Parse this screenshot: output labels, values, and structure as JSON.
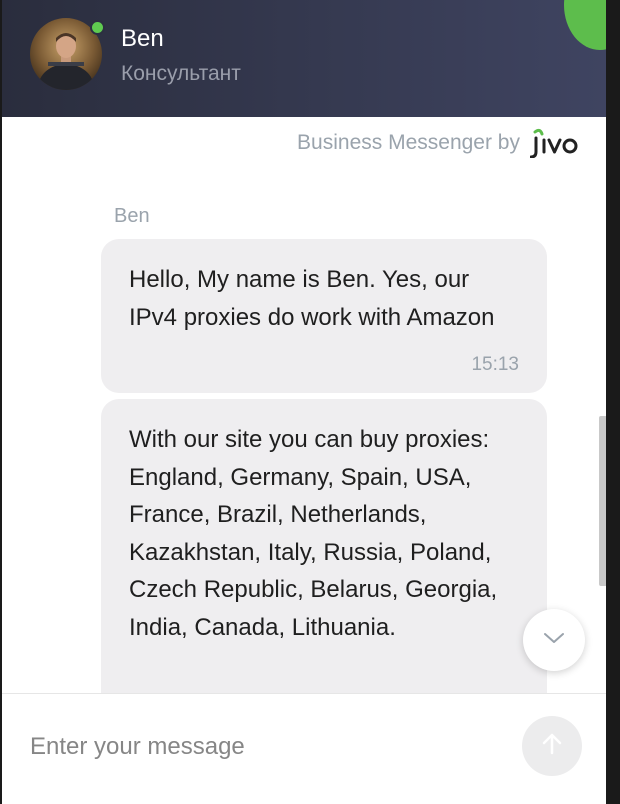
{
  "header": {
    "agent_name": "Ben",
    "agent_role": "Консультант",
    "online": true,
    "status_color": "#5fcb50"
  },
  "branding": {
    "text": "Business Messenger by",
    "logo_text": "jivo",
    "logo_accent": "#5dbd4c"
  },
  "chat": {
    "sender": "Ben",
    "messages": [
      {
        "text": "Hello, My name is Ben. Yes, our IPv4 proxies do work with Amazon",
        "time": "15:13"
      },
      {
        "text": "With our site you can buy proxies: England, Germany, Spain, USA, France, Brazil, Netherlands, Kazakhstan, Italy, Russia, Poland, Czech Republic, Belarus, Georgia, India, Canada, Lithuania."
      }
    ]
  },
  "controls": {
    "scroll_down_icon": "chevron-down-icon",
    "send_icon": "arrow-up-icon"
  },
  "composer": {
    "placeholder": "Enter your message",
    "value": ""
  }
}
